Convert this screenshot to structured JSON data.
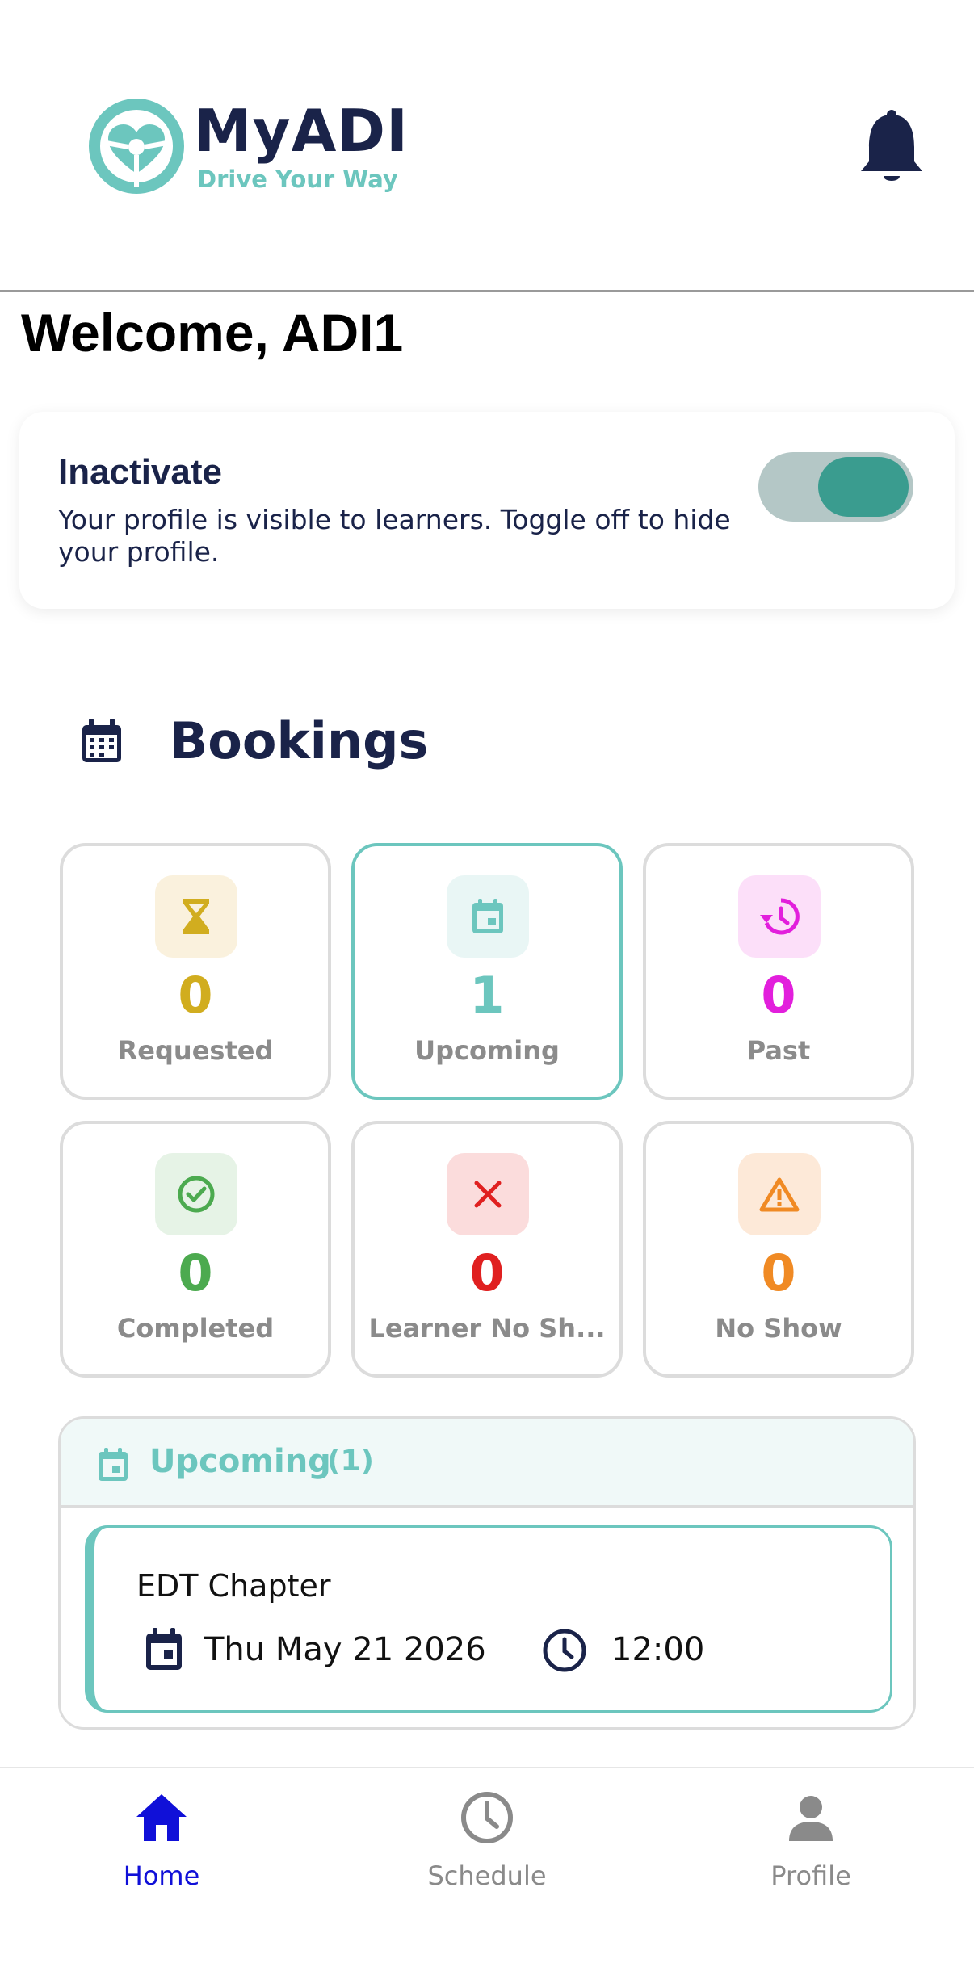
{
  "header": {
    "brand_name": "MyADI",
    "brand_tagline": "Drive Your Way",
    "brand_color": "#6cc6be",
    "notification_icon": "bell-icon"
  },
  "welcome": "Welcome, ADI1",
  "status": {
    "title": "Inactivate",
    "description": "Your profile is visible to learners. Toggle off to hide your profile.",
    "toggle_on": true
  },
  "bookings": {
    "title": "Bookings",
    "icon": "calendar-icon",
    "stats": [
      {
        "label": "Requested",
        "count": "0",
        "icon": "hourglass-icon",
        "color": "#d1ad1f"
      },
      {
        "label": "Upcoming",
        "count": "1",
        "icon": "calendar-icon",
        "color": "#6cc6be"
      },
      {
        "label": "Past",
        "count": "0",
        "icon": "history-icon",
        "color": "#e21fdc"
      },
      {
        "label": "Completed",
        "count": "0",
        "icon": "check-circle-icon",
        "color": "#4caa4f"
      },
      {
        "label": "Learner No Sh...",
        "count": "0",
        "icon": "close-icon",
        "color": "#e02020"
      },
      {
        "label": "No Show",
        "count": "0",
        "icon": "warning-icon",
        "color": "#f08a24"
      }
    ]
  },
  "upcoming": {
    "title": "Upcoming",
    "count": "(1)",
    "items": [
      {
        "name": "EDT Chapter",
        "date": "Thu May 21 2026",
        "time": "12:00"
      }
    ]
  },
  "nav": {
    "items": [
      {
        "label": "Home",
        "icon": "home-icon",
        "active": true
      },
      {
        "label": "Schedule",
        "icon": "clock-icon",
        "active": false
      },
      {
        "label": "Profile",
        "icon": "person-icon",
        "active": false
      }
    ]
  }
}
